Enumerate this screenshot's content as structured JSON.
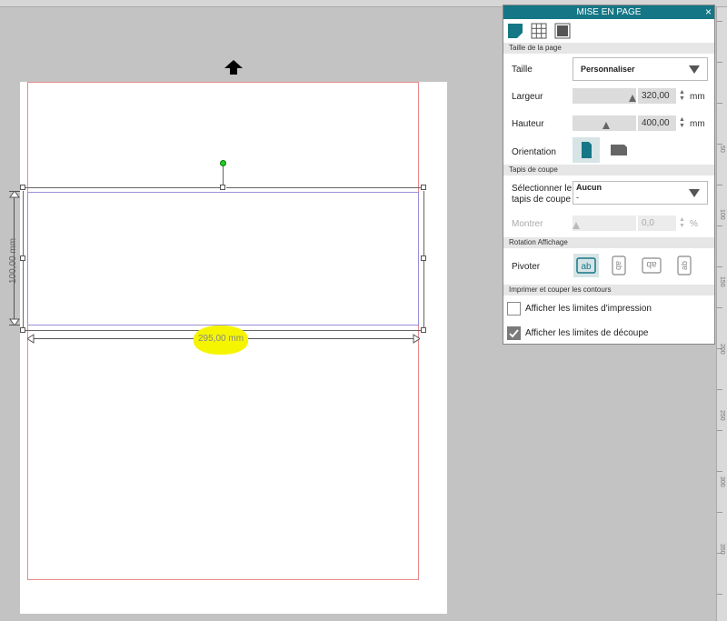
{
  "canvas": {
    "height_dimension": "100,00 mm",
    "width_dimension": "295,00 mm",
    "side_ruler_labels": [
      "50",
      "100",
      "150",
      "200",
      "250",
      "300",
      "350"
    ]
  },
  "panel": {
    "title": "MISE EN PAGE",
    "close": "×",
    "tabs": [
      "page-setup-icon",
      "grid-icon",
      "background-icon"
    ],
    "page_size": {
      "header": "Taille de la page",
      "size_label": "Taille",
      "size_value": "Personnaliser",
      "width_label": "Largeur",
      "width_value": "320,00",
      "height_label": "Hauteur",
      "height_value": "400,00",
      "unit": "mm",
      "orientation_label": "Orientation"
    },
    "cutting_mat": {
      "header": "Tapis de coupe",
      "select_label_1": "Sélectionner le",
      "select_label_2": "tapis de coupe",
      "select_value": "Aucun",
      "select_sub": "-",
      "show_label": "Montrer",
      "show_value": "0,0",
      "show_unit": "%"
    },
    "rotation": {
      "header": "Rotation Affichage",
      "pivot_label": "Pivoter",
      "buttons": [
        "ab",
        "ab",
        "ab",
        "ab"
      ]
    },
    "print_cut": {
      "header": "Imprimer et couper les contours",
      "print_limits_label": "Afficher les limites d'impression",
      "cut_limits_label": "Afficher les limites de découpe"
    }
  },
  "colors": {
    "accent": "#157785",
    "highlight": "#f5f500",
    "cut_boundary": "#e88a8a"
  }
}
